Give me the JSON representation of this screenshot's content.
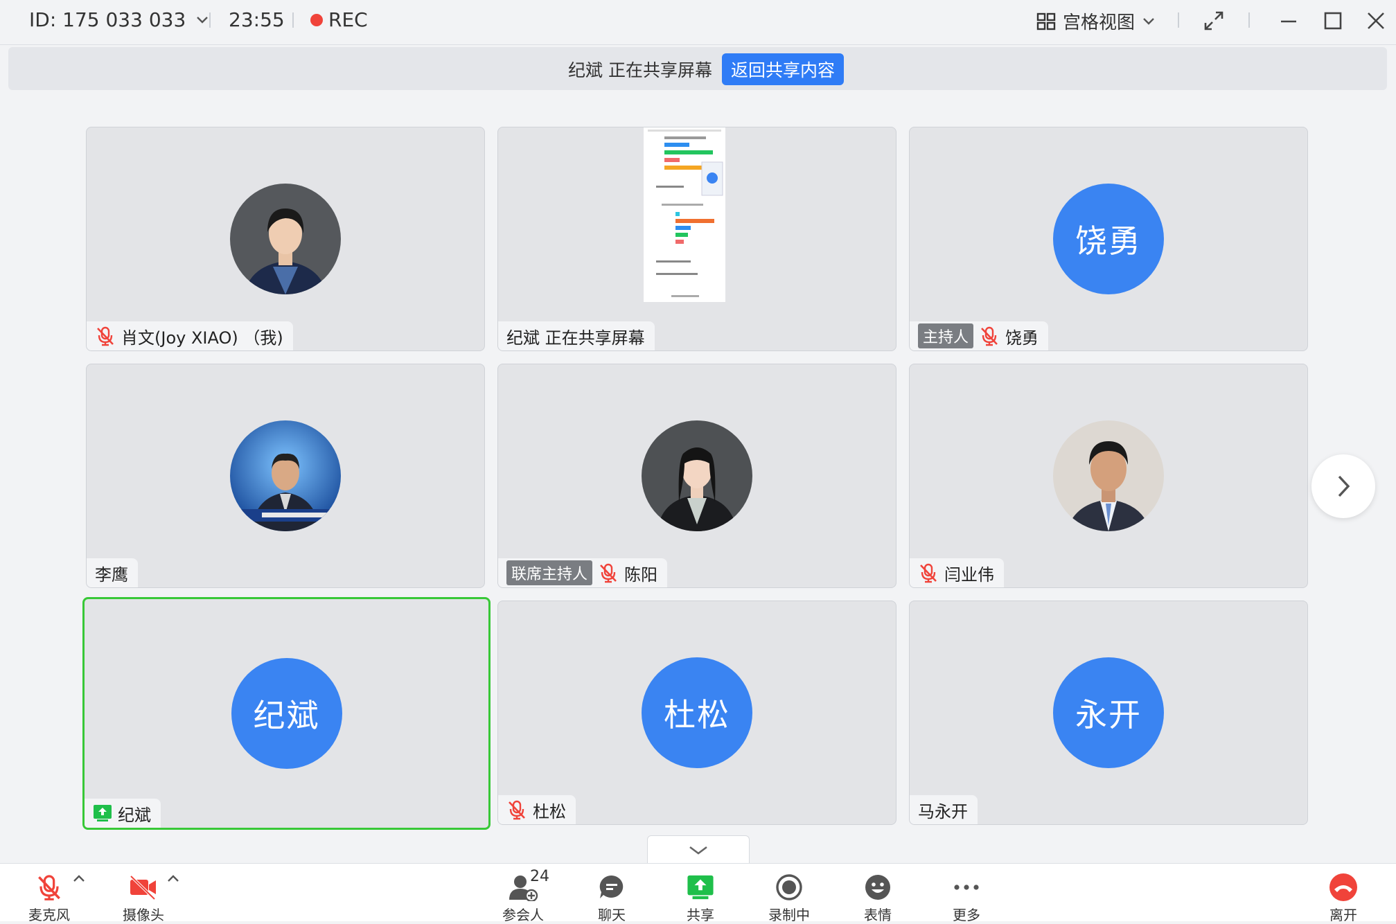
{
  "titlebar": {
    "meeting_id": "ID: 175 033 033",
    "timer": "23:55",
    "rec_label": "REC",
    "view_label": "宫格视图"
  },
  "banner": {
    "text": "纪斌 正在共享屏幕",
    "button": "返回共享内容"
  },
  "tiles": [
    {
      "name": "肖文(Joy XIAO) （我)",
      "role": "",
      "mic_muted": true,
      "avatar": "photo"
    },
    {
      "name": "纪斌 正在共享屏幕",
      "role": "",
      "mic_muted": false,
      "avatar": "screen"
    },
    {
      "name": "饶勇",
      "role": "主持人",
      "mic_muted": true,
      "avatar_text": "饶勇"
    },
    {
      "name": "李鹰",
      "role": "",
      "mic_muted": false,
      "avatar": "photo"
    },
    {
      "name": "陈阳",
      "role": "联席主持人",
      "mic_muted": true,
      "avatar": "photo"
    },
    {
      "name": "闫业伟",
      "role": "",
      "mic_muted": true,
      "avatar": "photo"
    },
    {
      "name": "纪斌",
      "role": "",
      "sharing": true,
      "avatar_text": "纪斌",
      "active": true
    },
    {
      "name": "杜松",
      "role": "",
      "mic_muted": true,
      "avatar_text": "杜松"
    },
    {
      "name": "马永开",
      "role": "",
      "mic_muted": false,
      "avatar_text": "永开"
    }
  ],
  "toolbar": {
    "mic": "麦克风",
    "camera": "摄像头",
    "participants": "参会人",
    "participant_count": "24",
    "chat": "聊天",
    "share": "共享",
    "recording": "录制中",
    "reactions": "表情",
    "more": "更多",
    "leave": "离开"
  },
  "colors": {
    "accent": "#2f7cf6",
    "muted_red": "#f0433a",
    "share_green": "#1fbf4a",
    "avatar_blue": "#3a84f2"
  }
}
